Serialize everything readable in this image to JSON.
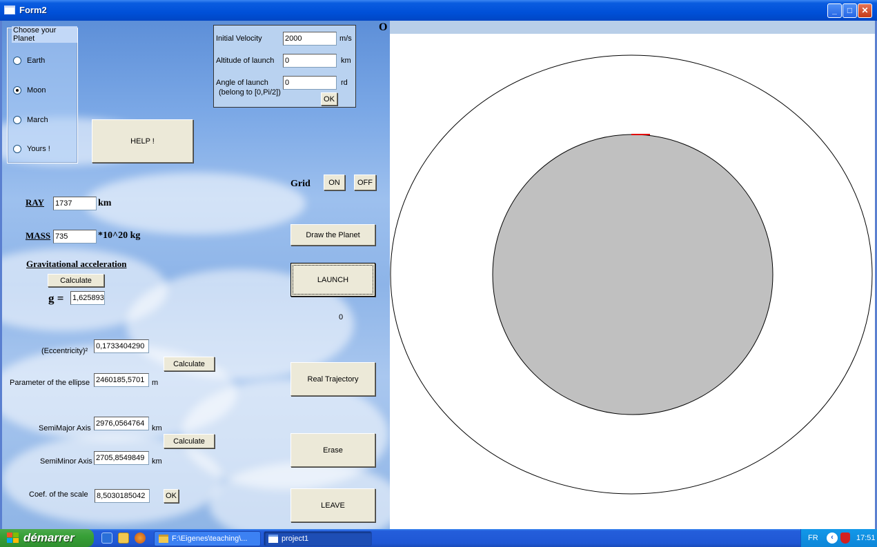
{
  "window": {
    "title": "Form2",
    "controls": {
      "minimize": "_",
      "maximize": "□",
      "close": "✕"
    }
  },
  "planet_selector": {
    "legend": "Choose your Planet",
    "options": [
      {
        "label": "Earth",
        "checked": false
      },
      {
        "label": "Moon",
        "checked": true
      },
      {
        "label": "March",
        "checked": false
      },
      {
        "label": "Yours !",
        "checked": false
      }
    ]
  },
  "help_button": "HELP !",
  "launch_params": {
    "velocity_label": "Initial Velocity",
    "velocity_value": "2000",
    "velocity_unit": "m/s",
    "altitude_label": "Altitude of launch",
    "altitude_value": "0",
    "altitude_unit": "km",
    "angle_label": "Angle of launch",
    "angle_hint": "(belong to [0,Pi/2])",
    "angle_value": "0",
    "angle_unit": "rd",
    "ok_button": "OK"
  },
  "planet_props": {
    "ray_label": "RAY",
    "ray_value": "1737",
    "ray_unit": "km",
    "mass_label": "MASS",
    "mass_value": "735",
    "mass_unit": "*10^20 kg",
    "grav_label": "Gravitational acceleration",
    "grav_calc_button": "Calculate",
    "g_label": "g =",
    "g_value": "1,625893"
  },
  "grid": {
    "label": "Grid",
    "on_button": "ON",
    "off_button": "OFF"
  },
  "actions": {
    "draw_planet": "Draw the Planet",
    "launch": "LAUNCH",
    "counter": "0",
    "real_trajectory": "Real Trajectory",
    "erase": "Erase",
    "leave": "LEAVE"
  },
  "orbit": {
    "ecc_label": "(Eccentricity)²",
    "ecc_value": "0,1733404290",
    "param_label": "Parameter of the ellipse",
    "param_value": "2460185,5701",
    "param_unit": "m",
    "calc1_button": "Calculate",
    "semimajor_label": "SemiMajor Axis",
    "semimajor_value": "2976,0564764",
    "semimajor_unit": "km",
    "semiminor_label": "SemiMinor Axis",
    "semiminor_value": "2705,8549849",
    "semiminor_unit": "km",
    "calc2_button": "Calculate",
    "scale_label": "Coef. of the scale",
    "scale_value": "8,5030185042",
    "scale_ok_button": "OK"
  },
  "canvas": {
    "origin_label": "O",
    "colors": {
      "planet_fill": "#c0c0c0",
      "launch_marker": "#e00000",
      "orbit": "#000000"
    }
  },
  "taskbar": {
    "start_label": "démarrer",
    "tasks": [
      {
        "label": "F:\\Eigenes\\teaching\\...",
        "active": false
      },
      {
        "label": "project1",
        "active": true
      }
    ],
    "tray": {
      "lang": "FR",
      "clock": "17:51"
    }
  }
}
